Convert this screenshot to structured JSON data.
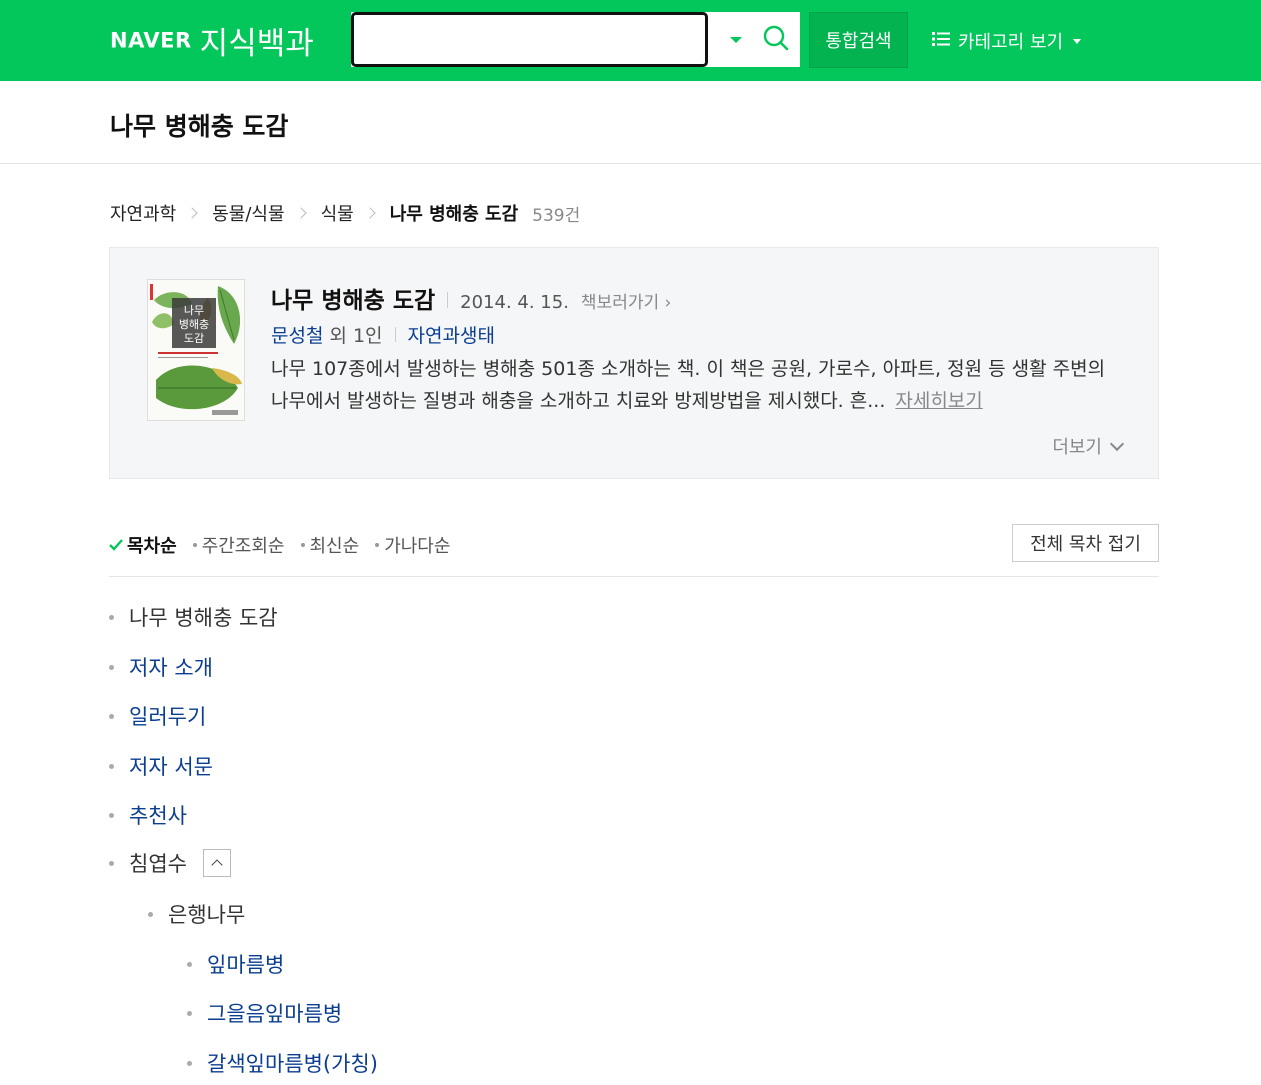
{
  "header": {
    "logo_brand": "NAVER",
    "logo_service": "지식백과",
    "search_value": "",
    "unified_search_label": "통합검색",
    "category_label": "카테고리 보기",
    "brand_color": "#03c75a"
  },
  "page_title": "나무 병해충 도감",
  "breadcrumb": {
    "items": [
      "자연과학",
      "동물/식물",
      "식물"
    ],
    "current": "나무 병해충 도감",
    "count": "539건"
  },
  "book": {
    "title": "나무 병해충 도감",
    "date": "2014. 4. 15.",
    "view_book_link": "책보러가기",
    "author": "문성철",
    "author_etc": "외 1인",
    "category": "자연과생태",
    "description": "나무 107종에서 발생하는 병해충 501종 소개하는 책. 이 책은 공원, 가로수, 아파트, 정원 등 생활 주변의 나무에서 발생하는 질병과 해충을 소개하고 치료와 방제방법을 제시했다. 흔...",
    "detail_link": "자세히보기",
    "more_label": "더보기",
    "cover_title_lines": [
      "나무",
      "병해충",
      "도감"
    ]
  },
  "sort": {
    "options": [
      "목차순",
      "주간조회순",
      "최신순",
      "가나다순"
    ],
    "active_index": 0,
    "fold_all_label": "전체 목차 접기"
  },
  "toc": [
    {
      "label": "나무 병해충 도감",
      "level": 0,
      "link": false
    },
    {
      "label": "저자 소개",
      "level": 0,
      "link": true
    },
    {
      "label": "일러두기",
      "level": 0,
      "link": true
    },
    {
      "label": "저자 서문",
      "level": 0,
      "link": true
    },
    {
      "label": "추천사",
      "level": 0,
      "link": true
    },
    {
      "label": "침엽수",
      "level": 0,
      "link": false,
      "expanded": true
    },
    {
      "label": "은행나무",
      "level": 1,
      "link": false
    },
    {
      "label": "잎마름병",
      "level": 2,
      "link": true
    },
    {
      "label": "그을음잎마름병",
      "level": 2,
      "link": true
    },
    {
      "label": "갈색잎마름병(가칭)",
      "level": 2,
      "link": true
    }
  ]
}
